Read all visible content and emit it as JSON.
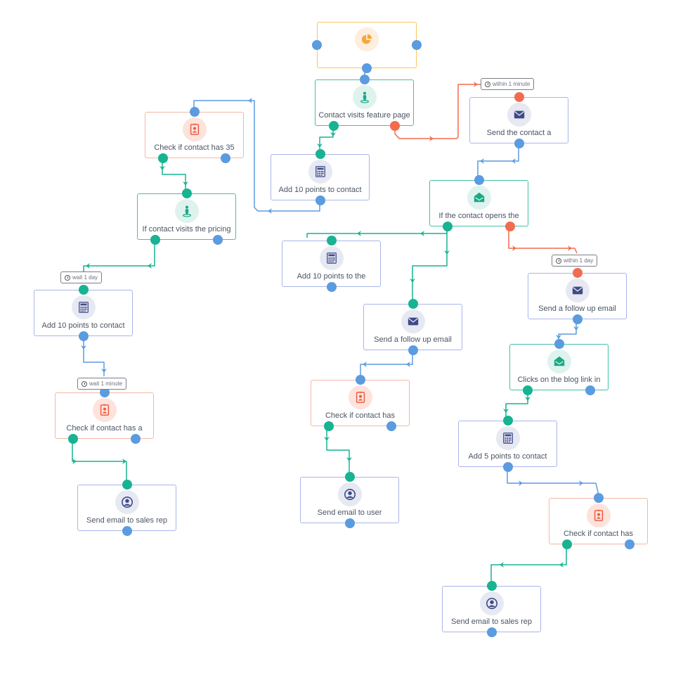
{
  "workflow": {
    "colors": {
      "yes_path": "#17b392",
      "no_path": "#f26c4f",
      "action_path": "#5b9be0",
      "trigger_border": "#43c1a5",
      "check_border": "#f4b8a6",
      "action_border": "#a9b6ea",
      "goal_border": "#f6c65b"
    },
    "nodes": [
      {
        "id": "goal",
        "type": "goal",
        "icon": "pie-chart-icon",
        "label": ""
      },
      {
        "id": "n1",
        "type": "trigger",
        "icon": "person-location-icon",
        "label": "Contact visits feature page"
      },
      {
        "id": "n2",
        "type": "action",
        "icon": "calculator-icon",
        "label": "Add 10 points to contact"
      },
      {
        "id": "n3",
        "type": "action",
        "icon": "envelope-icon",
        "label": "Send the contact a"
      },
      {
        "id": "n4",
        "type": "check",
        "icon": "contact-badge-icon",
        "label": "Check if contact has 35"
      },
      {
        "id": "n5",
        "type": "trigger",
        "icon": "person-location-icon",
        "label": "If contact visits the pricing"
      },
      {
        "id": "n6",
        "type": "trigger",
        "icon": "open-envelope-icon",
        "label": "If the contact opens the"
      },
      {
        "id": "n7",
        "type": "action",
        "icon": "calculator-icon",
        "label": "Add 10 points to the"
      },
      {
        "id": "n8",
        "type": "action",
        "icon": "calculator-icon",
        "label": "Add 10 points to contact"
      },
      {
        "id": "n9",
        "type": "action",
        "icon": "envelope-icon",
        "label": "Send a follow up email"
      },
      {
        "id": "n10",
        "type": "action",
        "icon": "envelope-icon",
        "label": "Send a follow up email"
      },
      {
        "id": "n11",
        "type": "trigger",
        "icon": "open-envelope-icon",
        "label": "Clicks on the blog link in"
      },
      {
        "id": "n12",
        "type": "check",
        "icon": "contact-badge-icon",
        "label": "Check if contact has a"
      },
      {
        "id": "n13",
        "type": "check",
        "icon": "contact-badge-icon",
        "label": "Check if contact has"
      },
      {
        "id": "n14",
        "type": "action",
        "icon": "calculator-icon",
        "label": "Add 5 points to contact"
      },
      {
        "id": "n15",
        "type": "action",
        "icon": "user-icon",
        "label": "Send email to sales rep"
      },
      {
        "id": "n16",
        "type": "action",
        "icon": "user-icon",
        "label": "Send email to user"
      },
      {
        "id": "n17",
        "type": "check",
        "icon": "contact-badge-icon",
        "label": "Check if contact has"
      },
      {
        "id": "n18",
        "type": "action",
        "icon": "user-icon",
        "label": "Send email to sales rep"
      }
    ],
    "badges": [
      {
        "id": "b1",
        "text": "within 1 minute"
      },
      {
        "id": "b2",
        "text": "wait 1 day"
      },
      {
        "id": "b3",
        "text": "within 1 day"
      },
      {
        "id": "b4",
        "text": "wait 1 minute"
      }
    ]
  }
}
